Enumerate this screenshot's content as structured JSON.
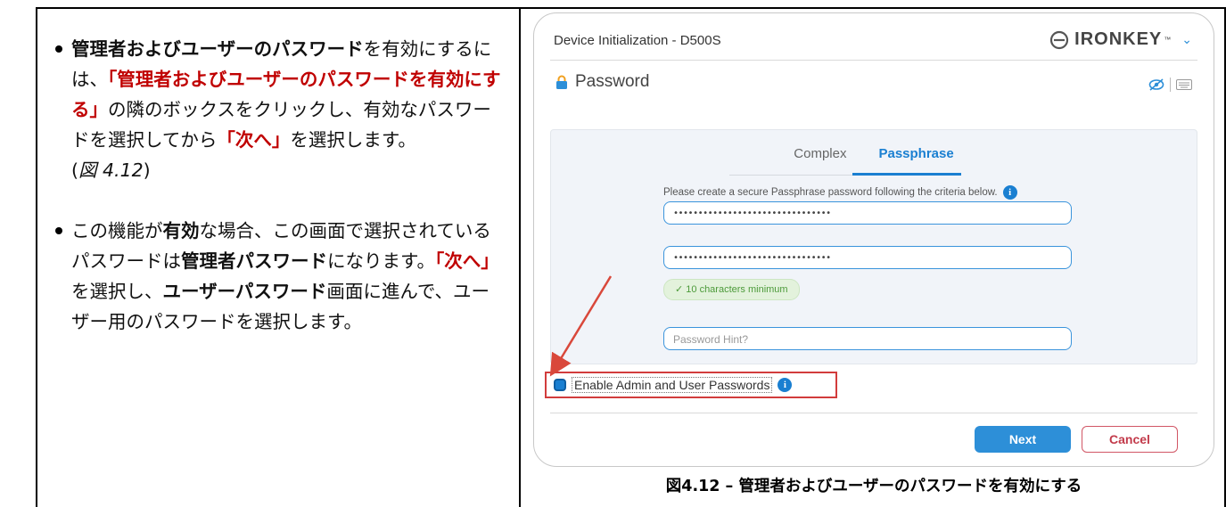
{
  "left": {
    "bullet1": {
      "b1": "管理者およびユーザーのパスワード",
      "t1": "を有効にするには、",
      "r1": "「管理者およびユーザーのパスワードを有効にする」",
      "t2": "の隣のボックスをクリックし、有効なパスワードを選択してから",
      "r2": "「次へ」",
      "t3": "を選択します。",
      "figref_open": "(",
      "figref": "図 4.12",
      "figref_close": ")"
    },
    "bullet2": {
      "t1": "この機能が",
      "b1": "有効",
      "t2": "な場合、この画面で選択されているパスワードは",
      "b2": "管理者パスワード",
      "t3": "になります。",
      "r1": "「次へ」",
      "t4": "を選択し、",
      "b3": "ユーザーパスワード",
      "t5": "画面に進んで、ユーザー用のパスワードを選択します。"
    }
  },
  "window": {
    "title": "Device Initialization - D500S",
    "brand": "IRONKEY",
    "brand_tm": "™",
    "section_title": "Password",
    "tabs": [
      "Complex",
      "Passphrase"
    ],
    "active_tab": "Passphrase",
    "criteria_text": "Please create a secure Passphrase password following the criteria below.",
    "password_mask": "••••••••••••••••••••••••••••••••",
    "confirm_mask": "••••••••••••••••••••••••••••••••",
    "badge": "✓ 10 characters minimum",
    "hint_placeholder": "Password Hint?",
    "enable_label": "Enable Admin and User Passwords",
    "enable_checked": true,
    "next_label": "Next",
    "cancel_label": "Cancel",
    "icons": [
      "logo-icon",
      "chevron-down-icon",
      "lock-icon",
      "eye-slash-icon",
      "keyboard-icon",
      "info-icon"
    ],
    "colors": {
      "accent": "#2d8fd8",
      "cancel": "#c23a4a",
      "highlight": "#d23c3c",
      "badge_text": "#4c9a3a"
    }
  },
  "caption": "図4.12 – 管理者およびユーザーのパスワードを有効にする"
}
